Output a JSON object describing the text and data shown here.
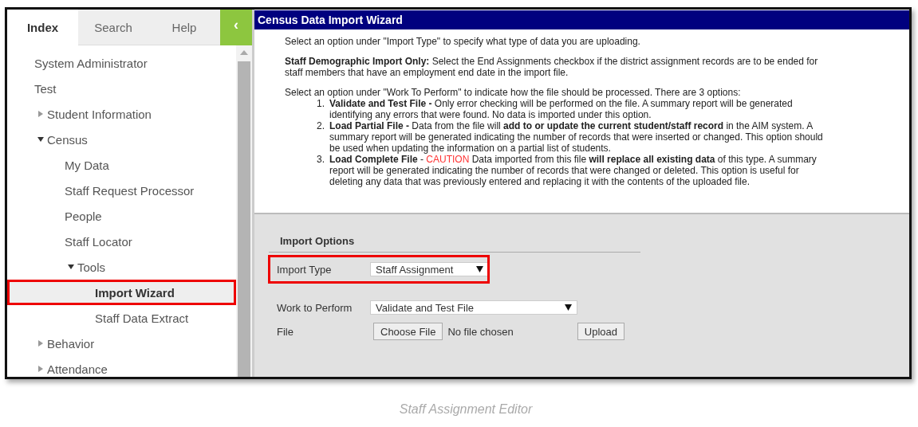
{
  "tabs": [
    {
      "label": "Index",
      "selected": true
    },
    {
      "label": "Search",
      "selected": false
    },
    {
      "label": "Help",
      "selected": false
    }
  ],
  "collapse_button": {
    "label": "‹"
  },
  "nav": [
    {
      "label": "System Administrator",
      "selected": false,
      "callout": false
    },
    {
      "label": "Test",
      "selected": false,
      "callout": false
    },
    {
      "label": "Student Information",
      "expanded": false,
      "selected": false,
      "callout": false
    },
    {
      "label": "Census",
      "expanded": true,
      "selected": false,
      "callout": false,
      "children": [
        {
          "label": "My Data",
          "selected": false,
          "callout": false
        },
        {
          "label": "Staff Request Processor",
          "selected": false,
          "callout": false
        },
        {
          "label": "People",
          "selected": false,
          "callout": false
        },
        {
          "label": "Staff Locator",
          "selected": false,
          "callout": false
        },
        {
          "label": "Tools",
          "expanded": true,
          "selected": false,
          "callout": false,
          "children": [
            {
              "label": "Import Wizard",
              "selected": true,
              "callout": true
            },
            {
              "label": "Staff Data Extract",
              "selected": false,
              "callout": false
            }
          ]
        }
      ]
    },
    {
      "label": "Behavior",
      "expanded": false,
      "selected": false,
      "callout": false
    },
    {
      "label": "Attendance",
      "expanded": false,
      "selected": false,
      "callout": false
    }
  ],
  "page_title": "Census Data Import Wizard",
  "intro": [
    {
      "kind": "paragraph",
      "text": "Select an option under \"Import Type\" to specify what type of data you are uploading."
    },
    {
      "kind": "paragraph",
      "text": "**Staff Demographic Import Only:** Select the End Assignments checkbox if the district assignment records are to be ended for staff members that have an employment end date in the import file."
    },
    {
      "kind": "lead",
      "text": "Select an option under \"Work To Perform\" to indicate how the file should be processed. There are 3 options:"
    }
  ],
  "options": [
    {
      "number": "1.",
      "text": "**Validate and Test File -** Only error checking will be performed on the file. A summary report will be generated identifying any errors that were found. No data is imported under this option."
    },
    {
      "number": "2.",
      "text": "**Load Partial File -** Data from the file will **add to or update the current student/staff record** in the AIM system. A summary report will be generated indicating the number of records that were inserted or changed. This option should be used when updating the information on a partial list of students."
    },
    {
      "number": "3.",
      "text": "**Load Complete File** - ",
      "warning": "CAUTION",
      "text_after": " Data imported from this file **will replace all existing data** of this type. A summary report will be generated indicating the number of records that were changed or deleted. This option is useful for deleting any data that was previously entered and replacing it with the contents of the uploaded file."
    }
  ],
  "import_options": {
    "heading": "Import Options",
    "import_type": {
      "label": "Import Type",
      "value": "Staff Assignment",
      "callout": true
    },
    "work_to_perform": {
      "label": "Work to Perform",
      "value": "Validate and Test File"
    },
    "file": {
      "label": "File",
      "button": "Choose File",
      "status": "No file chosen",
      "upload": "Upload"
    }
  },
  "caption": "Staff Assignment Editor"
}
